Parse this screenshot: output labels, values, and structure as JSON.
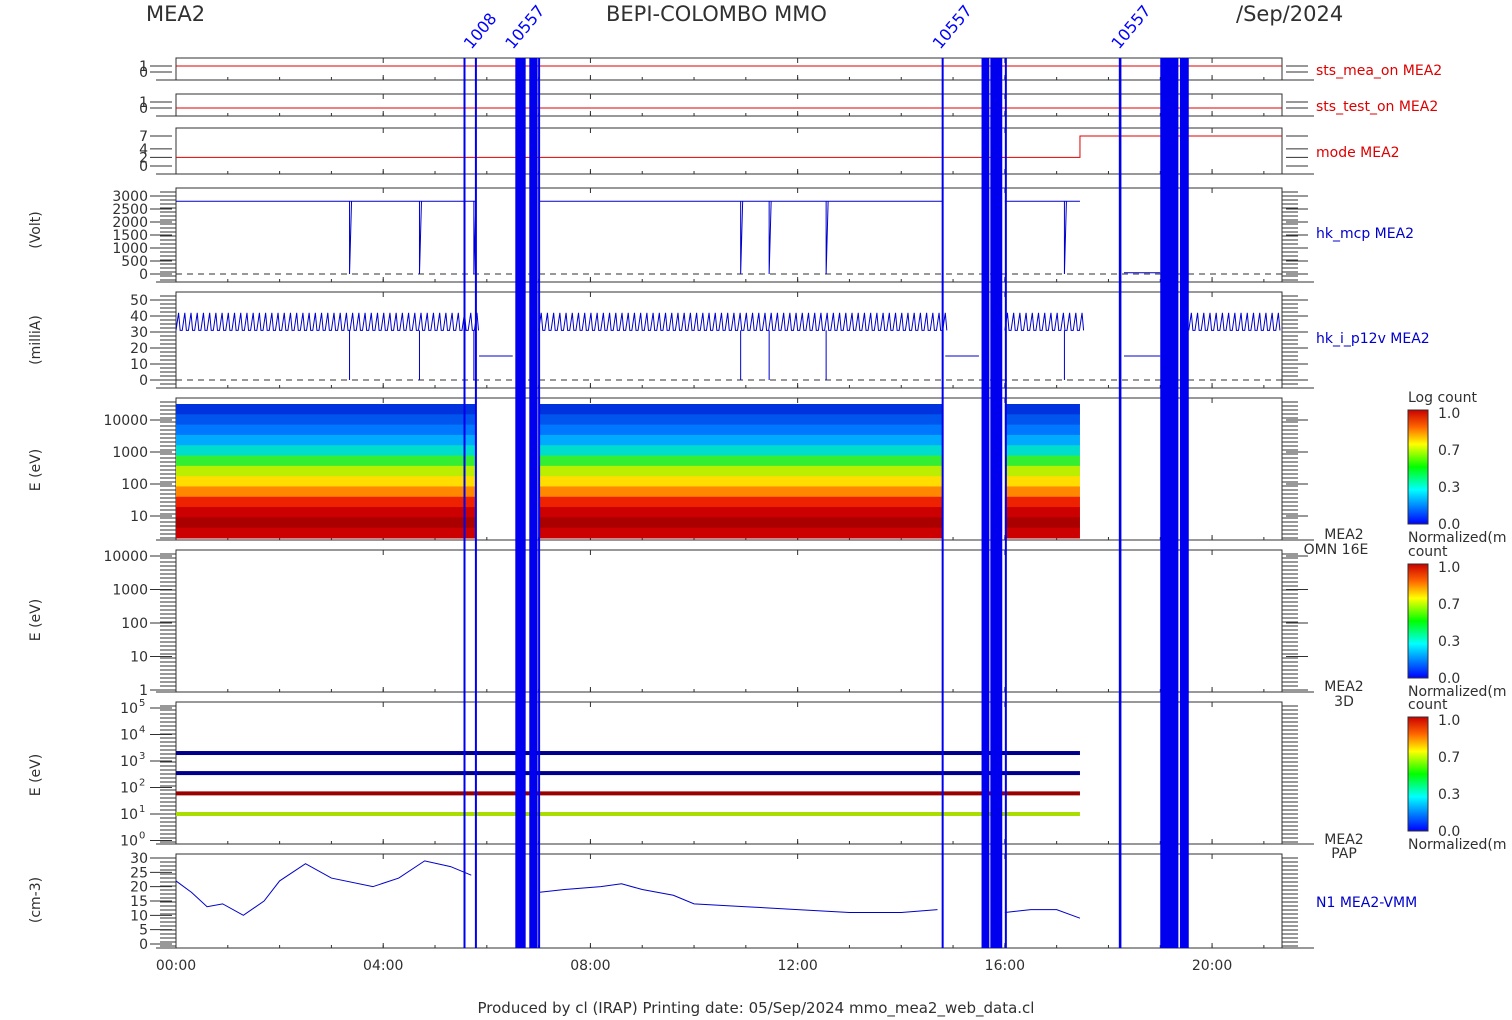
{
  "header": {
    "left": "MEA2",
    "center": "BEPI-COLOMBO MMO",
    "right": "/Sep/2024"
  },
  "footer": {
    "text": "Produced by cl (IRAP)   Printing date: 05/Sep/2024   mmo_mea2_web_data.cl"
  },
  "colors": {
    "axis": "#303030",
    "status_line": "#dd0000",
    "hk_line": "#0000cc",
    "gap_band": "#0000ee",
    "ion_line": "#0000ff"
  },
  "chart_data": [
    {
      "name": "sts_mea_on",
      "type": "line",
      "label": "sts_mea_on MEA2",
      "label_color": "#dd0000",
      "yticks": [
        "1",
        "0"
      ],
      "ylim": [
        0,
        1
      ],
      "x": [
        0,
        21.35
      ],
      "values": [
        1,
        1
      ]
    },
    {
      "name": "sts_test_on",
      "type": "line",
      "label": "sts_test_on MEA2",
      "label_color": "#dd0000",
      "yticks": [
        "1",
        "0"
      ],
      "ylim": [
        0,
        1
      ],
      "x": [
        0,
        21.35
      ],
      "values": [
        0,
        0
      ]
    },
    {
      "name": "mode",
      "type": "line",
      "label": "mode MEA2",
      "label_color": "#dd0000",
      "yticks": [
        "7",
        "4",
        "2",
        "0"
      ],
      "ylim": [
        0,
        7
      ],
      "x": [
        0,
        17.45,
        17.45,
        21.35
      ],
      "values": [
        2,
        2,
        7,
        7
      ]
    },
    {
      "name": "hk_mcp",
      "type": "line",
      "label": "hk_mcp MEA2",
      "label_color": "#0000cc",
      "ylabel": "(Volt)",
      "yticks": [
        "3000",
        "2500",
        "2000",
        "1500",
        "1000",
        "500",
        "0"
      ],
      "ylim": [
        0,
        3000
      ],
      "dropouts_hours": [
        3.35,
        4.7,
        5.75,
        10.9,
        11.45,
        12.55,
        17.15
      ],
      "level": 2800,
      "dashed_zero": true
    },
    {
      "name": "hk_i_p12v",
      "type": "line",
      "label": "hk_i_p12v MEA2",
      "label_color": "#0000cc",
      "ylabel": "(milliA)",
      "yticks": [
        "50",
        "40",
        "30",
        "20",
        "10",
        "0"
      ],
      "ylim": [
        0,
        50
      ],
      "baseline": 31,
      "spike_peak": 42,
      "dashed_zero": true
    },
    {
      "name": "omni_spectrogram",
      "type": "heatmap",
      "ylabel": "E (eV)",
      "yticks": [
        "10000",
        "1000",
        "100",
        "10"
      ],
      "yscale": "log",
      "side_label": [
        "MEA2",
        "OMN 16E"
      ],
      "colorbar": {
        "title": "Log count",
        "ticks": [
          "1.0",
          "0.7",
          "0.3",
          "0.0"
        ],
        "subtitle": "Normalized(m"
      },
      "data_intervals_hours": [
        [
          0,
          5.8
        ],
        [
          7.0,
          14.8
        ],
        [
          16.0,
          17.45
        ]
      ]
    },
    {
      "name": "spectrogram_3d",
      "type": "heatmap",
      "ylabel": "E (eV)",
      "yticks": [
        "10000",
        "1000",
        "100",
        "10",
        "1"
      ],
      "yscale": "log",
      "side_label": [
        "MEA2",
        "3D"
      ],
      "colorbar": {
        "title": "count",
        "ticks": [
          "1.0",
          "0.7",
          "0.3",
          "0.0"
        ],
        "subtitle": "Normalized(m"
      }
    },
    {
      "name": "pap_spectrogram",
      "type": "heatmap",
      "ylabel": "E (eV)",
      "ytick_exponents": [
        "5",
        "4",
        "3",
        "2",
        "1",
        "0"
      ],
      "yscale": "log",
      "side_label": [
        "MEA2",
        "PAP"
      ],
      "colorbar": {
        "title": "count",
        "ticks": [
          "1.0",
          "0.7",
          "0.3",
          "0.0"
        ],
        "subtitle": "Normalized(m"
      },
      "bands": [
        {
          "energy_eV": 2000,
          "color": "#00008b"
        },
        {
          "energy_eV": 350,
          "color": "#00008b"
        },
        {
          "energy_eV": 60,
          "color": "#990000"
        },
        {
          "energy_eV": 10,
          "color": "#aadd00"
        }
      ]
    },
    {
      "name": "density",
      "type": "line",
      "label": "N1 MEA2-VMM",
      "label_color": "#0000cc",
      "ylabel": "(cm-3)",
      "yticks": [
        "30",
        "25",
        "20",
        "15",
        "10",
        "5",
        "0"
      ],
      "ylim": [
        0,
        30
      ],
      "x": [
        0,
        0.3,
        0.6,
        0.9,
        1.3,
        1.7,
        2.0,
        2.5,
        3.0,
        3.8,
        4.3,
        4.8,
        5.3,
        5.7,
        7.0,
        7.5,
        8.2,
        8.6,
        9.0,
        9.6,
        10.0,
        11.0,
        12.0,
        13.0,
        14.0,
        14.7,
        16.0,
        16.5,
        17.0,
        17.45
      ],
      "values": [
        22,
        18,
        13,
        14,
        10,
        15,
        22,
        28,
        23,
        20,
        23,
        29,
        27,
        24,
        18,
        19,
        20,
        21,
        19,
        17,
        14,
        13,
        12,
        11,
        11,
        12,
        11,
        12,
        12,
        9
      ]
    }
  ],
  "x_axis": {
    "ticks": [
      "00:00",
      "04:00",
      "08:00",
      "12:00",
      "16:00",
      "20:00"
    ],
    "tick_hours": [
      0,
      4,
      8,
      12,
      16,
      20
    ],
    "range_hours": [
      0,
      21.35
    ]
  },
  "gaps_hours": [
    [
      5.55,
      5.56
    ],
    [
      5.77,
      5.79
    ],
    [
      6.55,
      6.75
    ],
    [
      6.82,
      6.98
    ],
    [
      6.99,
      7.01
    ],
    [
      14.78,
      14.81
    ],
    [
      15.55,
      15.7
    ],
    [
      15.72,
      15.95
    ],
    [
      16.0,
      16.02
    ],
    [
      18.2,
      18.25
    ],
    [
      19.0,
      19.35
    ],
    [
      19.38,
      19.55
    ]
  ],
  "top_labels": [
    {
      "hour": 5.7,
      "text": "1008"
    },
    {
      "hour": 6.5,
      "text": "10557"
    },
    {
      "hour": 14.75,
      "text": "10557"
    },
    {
      "hour": 18.2,
      "text": "10557"
    }
  ]
}
